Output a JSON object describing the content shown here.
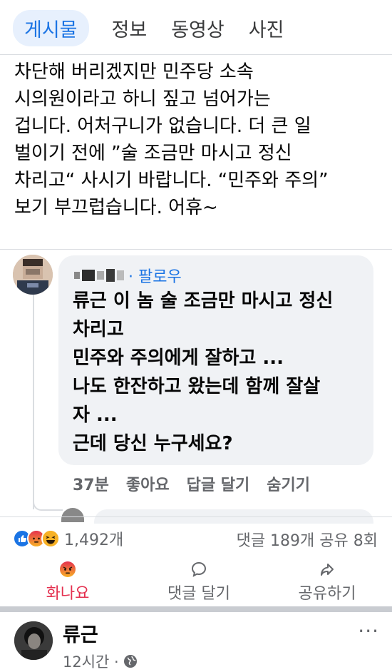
{
  "tabs": [
    {
      "label": "게시물",
      "active": true
    },
    {
      "label": "정보"
    },
    {
      "label": "동영상"
    },
    {
      "label": "사진"
    }
  ],
  "post": {
    "lines": [
      "차단해 버리겠지만 민주당 소속",
      "시의원이라고 하니 짚고 넘어가는",
      "겁니다. 어처구니가 없습니다. 더 큰 일",
      "벌이기 전에 ”술 조금만 마시고 정신",
      "차리고“ 사시기 바랍니다. “민주와 주의”",
      "보기 부끄럽습니다. 어휴~"
    ]
  },
  "comment": {
    "follow_label": "· 팔로우",
    "lines": [
      "류근 이 놈 술 조금만 마시고 정신",
      "차리고",
      "민주와 주의에게 잘하고 ...",
      " 나도 한잔하고 왔는데 함께 잘살",
      "자 ...",
      "근데 당신 누구세요?"
    ],
    "time": "37분",
    "like": "좋아요",
    "reply": "답글 달기",
    "hide": "숨기기"
  },
  "reactions": {
    "count": "1,492개",
    "icons": [
      "like-icon",
      "angry-icon",
      "haha-icon"
    ],
    "stats": "댓글 189개 공유 8회"
  },
  "buttons": {
    "angry": "화나요",
    "comment": "댓글 달기",
    "share": "공유하기"
  },
  "next_post": {
    "author": "류근",
    "time": "12시간 ·",
    "more": "···"
  },
  "colors": {
    "accent": "#1b74e4",
    "angry": "#e4304f",
    "muted": "#65676b",
    "bubble": "#f0f2f5"
  }
}
